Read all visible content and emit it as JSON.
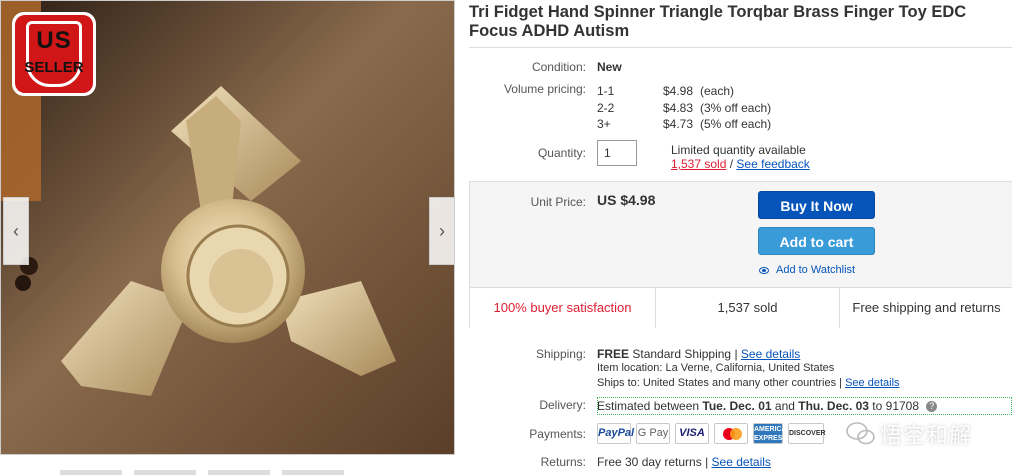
{
  "viewer": {
    "badge_line1": "US",
    "badge_line2": "SELLER",
    "prev_arrow": "‹",
    "next_arrow": "›"
  },
  "listing": {
    "title": "Tri Fidget Hand Spinner Triangle Torqbar Brass Finger Toy EDC Focus ADHD Autism",
    "condition_label": "Condition:",
    "condition_value": "New",
    "volume_label": "Volume pricing:",
    "volume_tiers": [
      {
        "qty": "1-1",
        "price": "$4.98",
        "note": "(each)"
      },
      {
        "qty": "2-2",
        "price": "$4.83",
        "note": "(3% off each)"
      },
      {
        "qty": "3+",
        "price": "$4.73",
        "note": "(5% off each)"
      }
    ],
    "quantity_label": "Quantity:",
    "quantity_value": "1",
    "availability": "Limited quantity available",
    "sold_link": "1,537 sold",
    "separator": "/",
    "feedback_link": "See feedback"
  },
  "buybox": {
    "unit_price_label": "Unit Price:",
    "unit_price": "US $4.98",
    "buy_now": "Buy It Now",
    "add_to_cart": "Add to cart",
    "watchlist": "Add to Watchlist",
    "stat_satisfaction": "100% buyer satisfaction",
    "stat_sold": "1,537 sold",
    "stat_shipping": "Free shipping and returns"
  },
  "shipping": {
    "label": "Shipping:",
    "free": "FREE",
    "method": "Standard Shipping",
    "pipe": "|",
    "details_link": "See details",
    "location_label": "Item location:",
    "location_value": "La Verne, California, United States",
    "ships_to_label": "Ships to:",
    "ships_to_value": "United States and many other countries",
    "ships_details_link": "See details"
  },
  "delivery": {
    "label": "Delivery:",
    "estimated": "Estimated between",
    "date1": "Tue. Dec. 01",
    "and": "and",
    "date2": "Thu. Dec. 03",
    "to": "to 91708",
    "help": "?"
  },
  "payments": {
    "label": "Payments:",
    "methods": [
      "PayPal",
      "G Pay",
      "VISA",
      "MasterCard",
      "AMERICAN EXPRESS",
      "DISCOVER"
    ]
  },
  "returns": {
    "label": "Returns:",
    "value": "Free 30 day returns",
    "pipe": "|",
    "details_link": "See details"
  },
  "watermark": "悟空和解",
  "colors": {
    "accent_blue": "#0654ba",
    "cart_blue": "#3a9bd9",
    "sold_red": "#dd1e31",
    "badge_red": "#d01616"
  }
}
